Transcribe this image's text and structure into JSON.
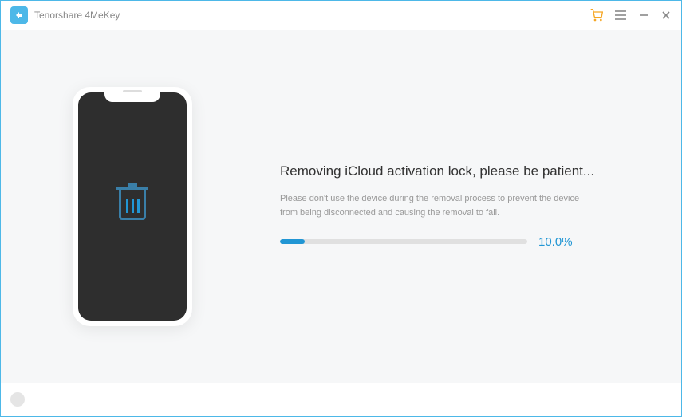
{
  "app": {
    "title": "Tenorshare 4MeKey"
  },
  "main": {
    "title": "Removing iCloud activation lock, please be patient...",
    "subtitle": "Please don't use the device during the removal process to prevent the device from being disconnected and causing the removal to fail.",
    "progress_percent": "10.0%",
    "progress_value": 10
  }
}
